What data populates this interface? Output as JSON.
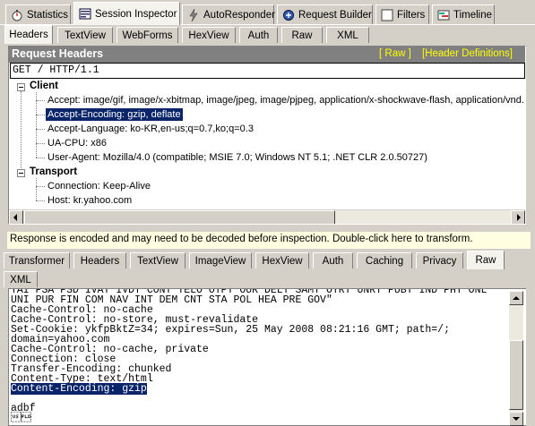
{
  "top_tabs": [
    {
      "label": "Statistics",
      "icon": "stopwatch-icon"
    },
    {
      "label": "Session Inspector",
      "icon": "inspector-icon"
    },
    {
      "label": "AutoResponder",
      "icon": "lightning-icon"
    },
    {
      "label": "Request Builder",
      "icon": "request-builder-icon"
    },
    {
      "label": "Filters",
      "icon": "checkbox-icon"
    },
    {
      "label": "Timeline",
      "icon": "timeline-icon"
    }
  ],
  "request_tabs": [
    "Headers",
    "TextView",
    "WebForms",
    "HexView",
    "Auth",
    "Raw",
    "XML"
  ],
  "request_headers": {
    "title": "Request Headers",
    "raw_link": "[ Raw ]",
    "definitions_link": "[Header Definitions]",
    "request_line": "GET / HTTP/1.1",
    "groups": [
      {
        "name": "Client",
        "items": [
          {
            "text": "Accept: image/gif, image/x-xbitmap, image/jpeg, image/pjpeg, application/x-shockwave-flash, application/vnd.",
            "selected": false
          },
          {
            "text": "Accept-Encoding: gzip, deflate",
            "selected": true
          },
          {
            "text": "Accept-Language: ko-KR,en-us;q=0.7,ko;q=0.3",
            "selected": false
          },
          {
            "text": "UA-CPU: x86",
            "selected": false
          },
          {
            "text": "User-Agent: Mozilla/4.0 (compatible; MSIE 7.0; Windows NT 5.1; .NET CLR 2.0.50727)",
            "selected": false
          }
        ]
      },
      {
        "name": "Transport",
        "items": [
          {
            "text": "Connection: Keep-Alive",
            "selected": false
          },
          {
            "text": "Host: kr.yahoo.com",
            "selected": false
          }
        ]
      }
    ]
  },
  "notice": "Response is encoded and may need to be decoded before inspection.  Double-click here to transform.",
  "response_tabs_row1": [
    "Transformer",
    "Headers",
    "TextView",
    "ImageView",
    "HexView",
    "Auth",
    "Caching",
    "Privacy",
    "Raw"
  ],
  "response_tabs_row2": [
    "XML"
  ],
  "response_active_tab": "Raw",
  "response_lines": [
    {
      "text": "TAI PSA PSD IVAT IVDT CONT TELO OTPT OUR DELT SAMT OTRT UNRT PUBT IND PHY ONL",
      "selected": false
    },
    {
      "text": "UNI PUR FIN COM NAV INT DEM CNT STA POL HEA PRE GOV\"",
      "selected": false
    },
    {
      "text": "Cache-Control: no-cache",
      "selected": false
    },
    {
      "text": "Cache-Control: no-store, must-revalidate",
      "selected": false
    },
    {
      "text": "Set-Cookie: ykfpBktZ=34; expires=Sun, 25 May 2008 08:21:16 GMT; path=/;",
      "selected": false
    },
    {
      "text": "domain=yahoo.com",
      "selected": false
    },
    {
      "text": "Cache-Control: no-cache, private",
      "selected": false
    },
    {
      "text": "Connection: close",
      "selected": false
    },
    {
      "text": "Transfer-Encoding: chunked",
      "selected": false
    },
    {
      "text": "Content-Type: text/html",
      "selected": false
    },
    {
      "text": "Content-Encoding: gzip",
      "selected": true
    },
    {
      "text": "",
      "selected": false
    },
    {
      "text": "adbf",
      "selected": false
    },
    {
      "text": "\u001f",
      "selected": false
    }
  ],
  "colors": {
    "panel_bg": "#d4d0c8",
    "title_bar": "#808080",
    "link_yellow": "#ffff00",
    "selection": "#0a246a",
    "notice_bg": "#ffffe1"
  }
}
